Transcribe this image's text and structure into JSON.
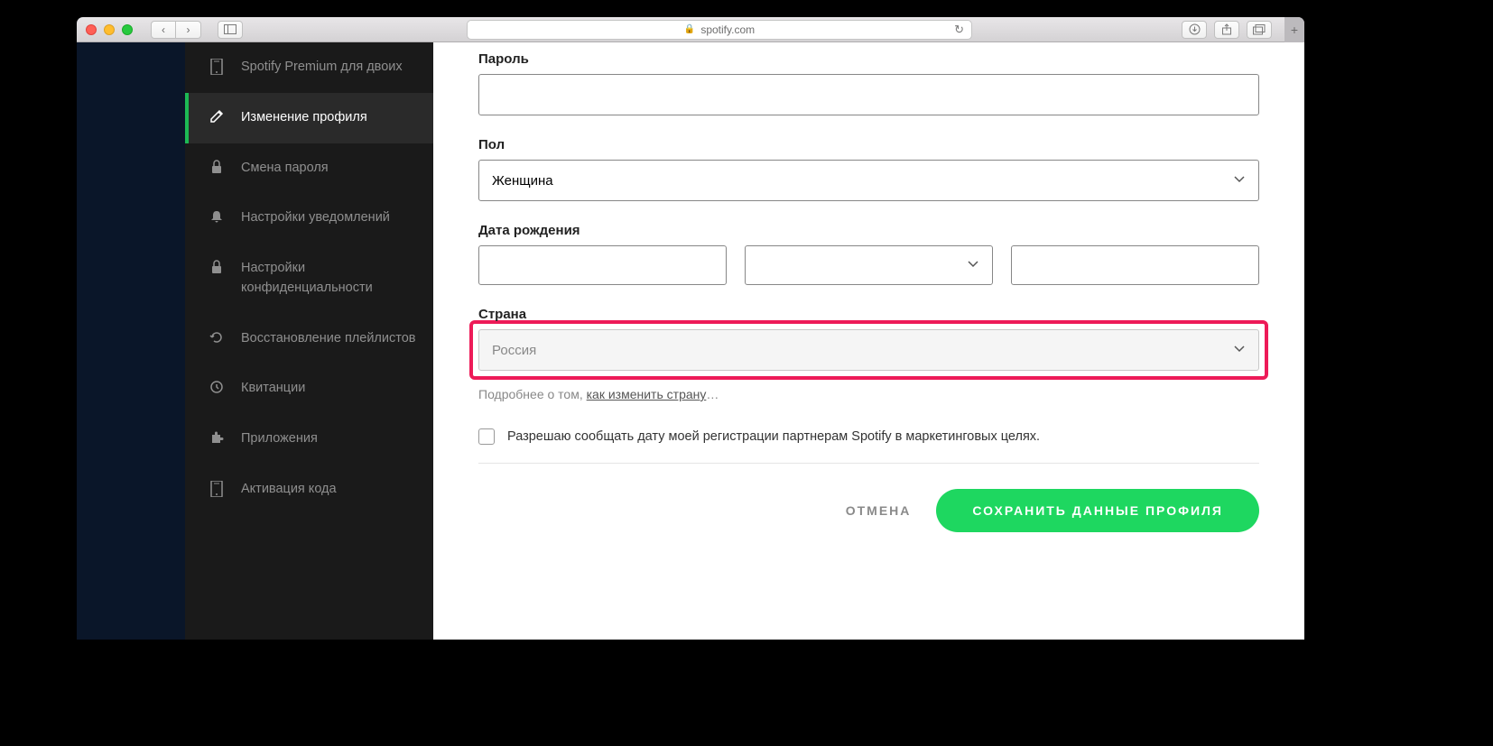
{
  "browser": {
    "url_display": "spotify.com"
  },
  "sidebar": {
    "items": [
      {
        "label": "Spotify Premium для двоих"
      },
      {
        "label": "Изменение профиля"
      },
      {
        "label": "Смена пароля"
      },
      {
        "label": "Настройки уведомлений"
      },
      {
        "label": "Настройки конфиденциальности"
      },
      {
        "label": "Восстановление плейлистов"
      },
      {
        "label": "Квитанции"
      },
      {
        "label": "Приложения"
      },
      {
        "label": "Активация кода"
      }
    ]
  },
  "form": {
    "password_label": "Пароль",
    "password_value": "",
    "gender_label": "Пол",
    "gender_value": "Женщина",
    "dob_label": "Дата рождения",
    "dob_day": "",
    "dob_month": "",
    "dob_year": "",
    "country_label": "Страна",
    "country_value": "Россия",
    "country_note_prefix": "Подробнее о том, ",
    "country_note_link": "как изменить страну",
    "country_note_suffix": "…",
    "marketing_checkbox_label": "Разрешаю сообщать дату моей регистрации партнерам Spotify в маркетинговых целях.",
    "marketing_checked": false
  },
  "actions": {
    "cancel": "ОТМЕНА",
    "save": "СОХРАНИТЬ ДАННЫЕ ПРОФИЛЯ"
  },
  "colors": {
    "accent": "#1ed760",
    "highlight": "#ed1b58"
  }
}
